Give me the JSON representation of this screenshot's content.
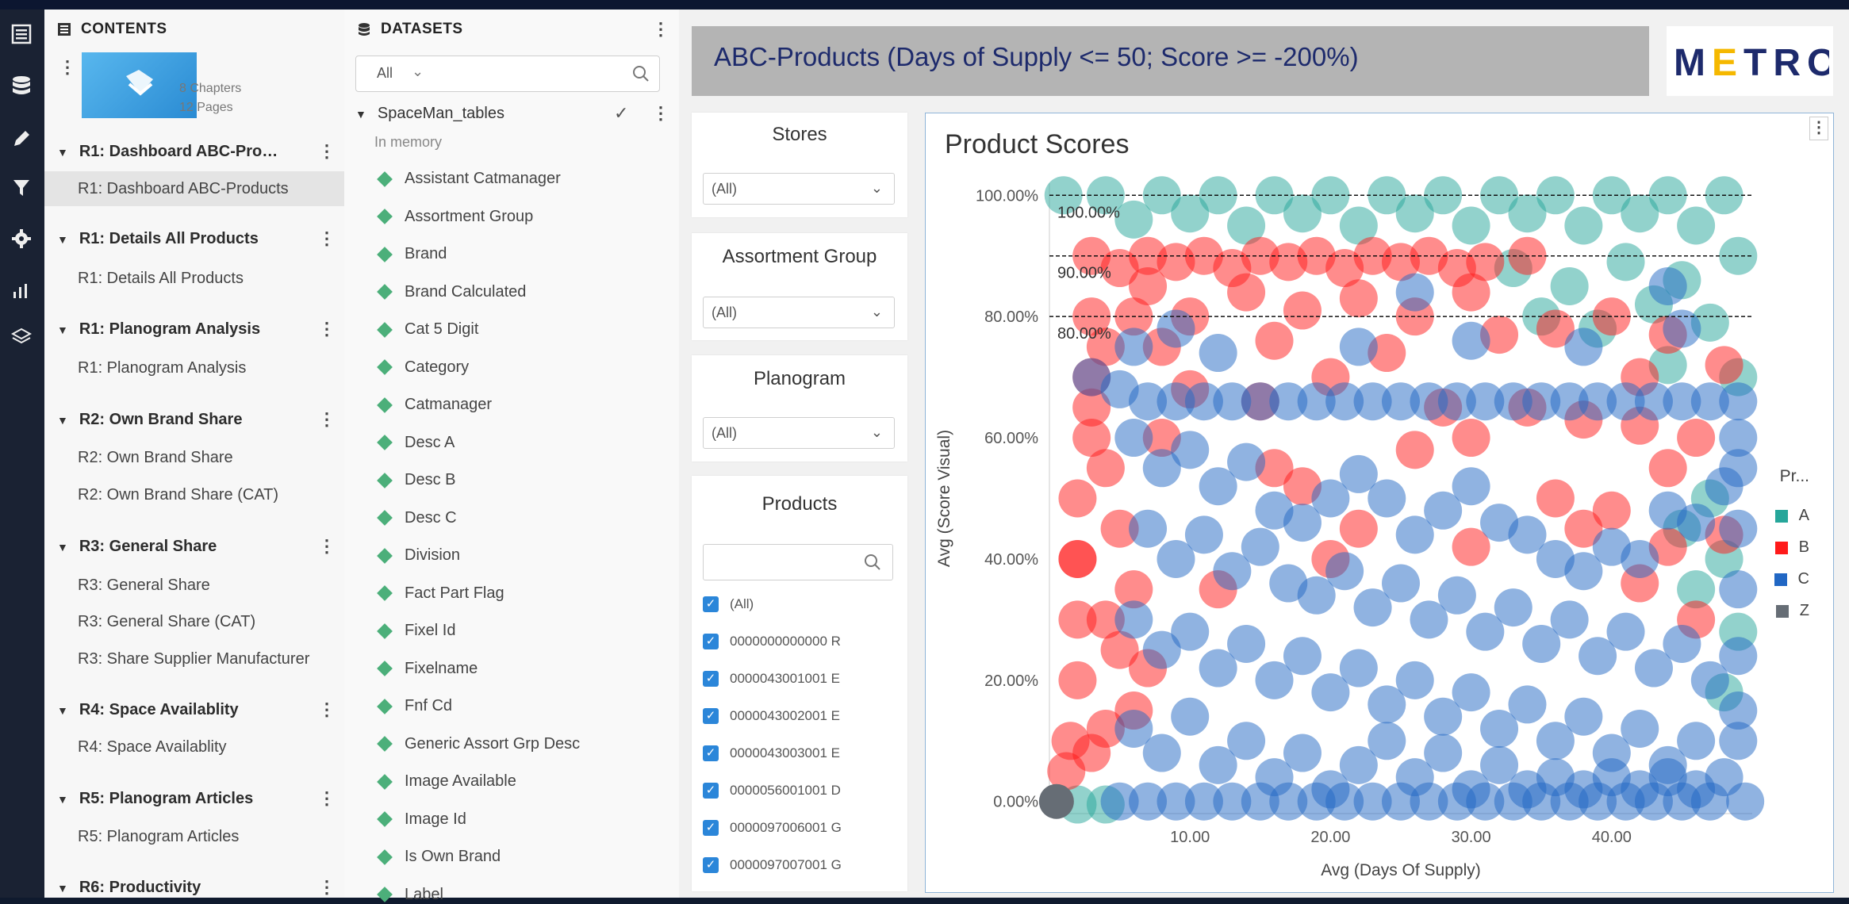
{
  "contents": {
    "header": "CONTENTS",
    "stats": {
      "chapters": "8 Chapters",
      "pages": "12 Pages"
    },
    "chapters": [
      {
        "title": "R1: Dashboard ABC-Pro…",
        "pages": [
          "R1: Dashboard ABC-Products"
        ]
      },
      {
        "title": "R1: Details All Products",
        "pages": [
          "R1: Details All Products"
        ]
      },
      {
        "title": "R1: Planogram Analysis",
        "pages": [
          "R1: Planogram Analysis"
        ]
      },
      {
        "title": "R2: Own Brand Share",
        "pages": [
          "R2: Own Brand Share",
          "R2: Own Brand Share (CAT)"
        ]
      },
      {
        "title": "R3: General Share",
        "pages": [
          "R3: General Share",
          "R3: General Share (CAT)",
          "R3: Share Supplier Manufacturer"
        ]
      },
      {
        "title": "R4: Space Availablity",
        "pages": [
          "R4: Space Availablity"
        ]
      },
      {
        "title": "R5: Planogram Articles",
        "pages": [
          "R5: Planogram Articles"
        ]
      },
      {
        "title": "R6: Productivity",
        "pages": []
      }
    ]
  },
  "datasets": {
    "header": "DATASETS",
    "filter": "All",
    "dataset_name": "SpaceMan_tables",
    "dataset_status": "In memory",
    "attributes": [
      "Assistant Catmanager",
      "Assortment Group",
      "Brand",
      "Brand Calculated",
      "Cat 5 Digit",
      "Category",
      "Catmanager",
      "Desc A",
      "Desc B",
      "Desc C",
      "Division",
      "Fact Part Flag",
      "Fixel Id",
      "Fixelname",
      "Fnf Cd",
      "Generic Assort Grp Desc",
      "Image Available",
      "Image Id",
      "Is Own Brand",
      "Label"
    ]
  },
  "dashboard": {
    "title": "ABC-Products (Days of Supply <= 50; Score >= -200%)",
    "logo": "METRO",
    "filters": [
      {
        "title": "Stores",
        "value": "(All)"
      },
      {
        "title": "Assortment Group",
        "value": "(All)"
      },
      {
        "title": "Planogram",
        "value": "(All)"
      }
    ],
    "products": {
      "title": "Products",
      "items": [
        "(All)",
        "0000000000000 R",
        "0000043001001 E",
        "0000043002001 E",
        "0000043003001 E",
        "0000056001001 D",
        "0000097006001 G",
        "0000097007001 G"
      ]
    }
  },
  "chart_data": {
    "type": "scatter",
    "title": "Product Scores",
    "xlabel": "Avg (Days Of Supply)",
    "ylabel": "Avg (Score Visual)",
    "xlim": [
      0,
      50
    ],
    "ylim": [
      -2,
      102
    ],
    "x_ticks": [
      "10.00",
      "20.00",
      "30.00",
      "40.00"
    ],
    "y_ticks": [
      "0.00%",
      "20.00%",
      "40.00%",
      "60.00%",
      "80.00%",
      "100.00%"
    ],
    "reference_lines": [
      {
        "value": 100,
        "label": "100.00%"
      },
      {
        "value": 90,
        "label": "90.00%"
      },
      {
        "value": 80,
        "label": "80.00%"
      }
    ],
    "legend_title": "Pr...",
    "legend_position": "right",
    "series": [
      {
        "name": "A",
        "color": "#26a69a",
        "points": [
          [
            1,
            100
          ],
          [
            4,
            100
          ],
          [
            8,
            100
          ],
          [
            12,
            100
          ],
          [
            16,
            100
          ],
          [
            20,
            100
          ],
          [
            24,
            100
          ],
          [
            28,
            100
          ],
          [
            32,
            100
          ],
          [
            36,
            100
          ],
          [
            40,
            100
          ],
          [
            44,
            100
          ],
          [
            48,
            100
          ],
          [
            6,
            96
          ],
          [
            10,
            97
          ],
          [
            14,
            95
          ],
          [
            18,
            97
          ],
          [
            22,
            95
          ],
          [
            26,
            97
          ],
          [
            30,
            95
          ],
          [
            34,
            97
          ],
          [
            38,
            95
          ],
          [
            42,
            97
          ],
          [
            46,
            95
          ],
          [
            33,
            88
          ],
          [
            37,
            85
          ],
          [
            41,
            89
          ],
          [
            45,
            86
          ],
          [
            49,
            90
          ],
          [
            35,
            80
          ],
          [
            39,
            78
          ],
          [
            43,
            82
          ],
          [
            47,
            79
          ],
          [
            49,
            70
          ],
          [
            44,
            72
          ],
          [
            47,
            50
          ],
          [
            45,
            45
          ],
          [
            48,
            40
          ],
          [
            46,
            35
          ],
          [
            49,
            28
          ],
          [
            48,
            18
          ],
          [
            2,
            -0.5
          ],
          [
            4,
            -0.5
          ]
        ]
      },
      {
        "name": "B",
        "color": "#ff1a1a",
        "points": [
          [
            3,
            90
          ],
          [
            5,
            88
          ],
          [
            7,
            90
          ],
          [
            9,
            89
          ],
          [
            11,
            90
          ],
          [
            13,
            88
          ],
          [
            15,
            90
          ],
          [
            17,
            89
          ],
          [
            19,
            90
          ],
          [
            21,
            88
          ],
          [
            23,
            90
          ],
          [
            25,
            89
          ],
          [
            27,
            90
          ],
          [
            29,
            88
          ],
          [
            31,
            89
          ],
          [
            34,
            90
          ],
          [
            3,
            80
          ],
          [
            3,
            70
          ],
          [
            3,
            60
          ],
          [
            2,
            50
          ],
          [
            2,
            40
          ],
          [
            2,
            30
          ],
          [
            2,
            20
          ],
          [
            1.5,
            10
          ],
          [
            1.2,
            5
          ],
          [
            4,
            55
          ],
          [
            5,
            45
          ],
          [
            6,
            35
          ],
          [
            5,
            25
          ],
          [
            7,
            85
          ],
          [
            10,
            80
          ],
          [
            14,
            84
          ],
          [
            18,
            81
          ],
          [
            22,
            83
          ],
          [
            26,
            80
          ],
          [
            30,
            84
          ],
          [
            8,
            75
          ],
          [
            16,
            76
          ],
          [
            24,
            74
          ],
          [
            32,
            77
          ],
          [
            36,
            78
          ],
          [
            40,
            80
          ],
          [
            44,
            77
          ],
          [
            42,
            70
          ],
          [
            48,
            72
          ],
          [
            28,
            65
          ],
          [
            34,
            65
          ],
          [
            38,
            63
          ],
          [
            42,
            62
          ],
          [
            46,
            60
          ],
          [
            30,
            60
          ],
          [
            26,
            58
          ],
          [
            16,
            55
          ],
          [
            18,
            52
          ],
          [
            44,
            55
          ],
          [
            40,
            48
          ],
          [
            36,
            50
          ],
          [
            22,
            45
          ],
          [
            30,
            42
          ],
          [
            38,
            45
          ],
          [
            44,
            42
          ],
          [
            48,
            44
          ],
          [
            42,
            36
          ],
          [
            46,
            30
          ],
          [
            12,
            35
          ],
          [
            20,
            40
          ],
          [
            8,
            60
          ],
          [
            10,
            68
          ],
          [
            20,
            70
          ],
          [
            15,
            66
          ],
          [
            3,
            65
          ],
          [
            4,
            75
          ],
          [
            6,
            80
          ],
          [
            2,
            40
          ],
          [
            4,
            30
          ],
          [
            4,
            12
          ],
          [
            3,
            8
          ],
          [
            6,
            15
          ],
          [
            7,
            22
          ]
        ]
      },
      {
        "name": "C",
        "color": "#2167c4",
        "points": [
          [
            3,
            70
          ],
          [
            5,
            68
          ],
          [
            7,
            66
          ],
          [
            9,
            66
          ],
          [
            11,
            66
          ],
          [
            13,
            66
          ],
          [
            15,
            66
          ],
          [
            17,
            66
          ],
          [
            19,
            66
          ],
          [
            21,
            66
          ],
          [
            23,
            66
          ],
          [
            25,
            66
          ],
          [
            27,
            66
          ],
          [
            29,
            66
          ],
          [
            31,
            66
          ],
          [
            33,
            66
          ],
          [
            35,
            66
          ],
          [
            37,
            66
          ],
          [
            39,
            66
          ],
          [
            41,
            66
          ],
          [
            43,
            66
          ],
          [
            45,
            66
          ],
          [
            47,
            66
          ],
          [
            49,
            66
          ],
          [
            6,
            75
          ],
          [
            9,
            78
          ],
          [
            12,
            74
          ],
          [
            6,
            60
          ],
          [
            8,
            55
          ],
          [
            10,
            58
          ],
          [
            12,
            52
          ],
          [
            14,
            56
          ],
          [
            16,
            48
          ],
          [
            18,
            46
          ],
          [
            20,
            50
          ],
          [
            22,
            54
          ],
          [
            24,
            50
          ],
          [
            26,
            44
          ],
          [
            28,
            48
          ],
          [
            30,
            52
          ],
          [
            32,
            46
          ],
          [
            34,
            44
          ],
          [
            36,
            40
          ],
          [
            38,
            38
          ],
          [
            40,
            42
          ],
          [
            42,
            40
          ],
          [
            44,
            48
          ],
          [
            46,
            46
          ],
          [
            48,
            52
          ],
          [
            7,
            45
          ],
          [
            9,
            40
          ],
          [
            11,
            44
          ],
          [
            13,
            38
          ],
          [
            15,
            42
          ],
          [
            17,
            36
          ],
          [
            19,
            34
          ],
          [
            21,
            38
          ],
          [
            23,
            32
          ],
          [
            25,
            36
          ],
          [
            27,
            30
          ],
          [
            29,
            34
          ],
          [
            31,
            28
          ],
          [
            33,
            32
          ],
          [
            35,
            26
          ],
          [
            37,
            30
          ],
          [
            39,
            24
          ],
          [
            41,
            28
          ],
          [
            43,
            22
          ],
          [
            45,
            26
          ],
          [
            47,
            20
          ],
          [
            49,
            24
          ],
          [
            6,
            30
          ],
          [
            8,
            25
          ],
          [
            10,
            28
          ],
          [
            12,
            22
          ],
          [
            14,
            26
          ],
          [
            16,
            20
          ],
          [
            18,
            24
          ],
          [
            20,
            18
          ],
          [
            22,
            22
          ],
          [
            24,
            16
          ],
          [
            26,
            20
          ],
          [
            28,
            14
          ],
          [
            30,
            18
          ],
          [
            32,
            12
          ],
          [
            34,
            16
          ],
          [
            36,
            10
          ],
          [
            38,
            14
          ],
          [
            40,
            8
          ],
          [
            42,
            12
          ],
          [
            44,
            6
          ],
          [
            46,
            10
          ],
          [
            48,
            4
          ],
          [
            6,
            12
          ],
          [
            8,
            8
          ],
          [
            10,
            14
          ],
          [
            12,
            6
          ],
          [
            14,
            10
          ],
          [
            16,
            4
          ],
          [
            18,
            8
          ],
          [
            20,
            2
          ],
          [
            22,
            6
          ],
          [
            24,
            10
          ],
          [
            26,
            4
          ],
          [
            28,
            8
          ],
          [
            30,
            2
          ],
          [
            32,
            6
          ],
          [
            34,
            2
          ],
          [
            36,
            4
          ],
          [
            38,
            2
          ],
          [
            40,
            4
          ],
          [
            42,
            2
          ],
          [
            44,
            4
          ],
          [
            46,
            2
          ],
          [
            5,
            0
          ],
          [
            7,
            0
          ],
          [
            9,
            0
          ],
          [
            11,
            0
          ],
          [
            13,
            0
          ],
          [
            15,
            0
          ],
          [
            17,
            0
          ],
          [
            19,
            0
          ],
          [
            21,
            0
          ],
          [
            23,
            0
          ],
          [
            25,
            0
          ],
          [
            27,
            0
          ],
          [
            29,
            0
          ],
          [
            31,
            0
          ],
          [
            33,
            0
          ],
          [
            35,
            0
          ],
          [
            37,
            0
          ],
          [
            39,
            0
          ],
          [
            41,
            0
          ],
          [
            43,
            0
          ],
          [
            45,
            0
          ],
          [
            47,
            0
          ],
          [
            49.5,
            0
          ],
          [
            49,
            10
          ],
          [
            49,
            15
          ],
          [
            49,
            35
          ],
          [
            49,
            45
          ],
          [
            49,
            55
          ],
          [
            49,
            60
          ],
          [
            22,
            75
          ],
          [
            30,
            76
          ],
          [
            38,
            75
          ],
          [
            45,
            78
          ],
          [
            26,
            84
          ],
          [
            44,
            85
          ]
        ]
      },
      {
        "name": "Z",
        "color": "#666d75",
        "points": [
          [
            0.5,
            0
          ]
        ]
      }
    ]
  },
  "colors": {
    "accent": "#2b86d9",
    "title_bar": "#b4b4b4",
    "title_text": "#1d2a6c",
    "diamond": "#4caf7a",
    "logo_yellow": "#f5b800",
    "logo_blue": "#1d2a6c"
  },
  "icons": [
    "table-of-contents-icon",
    "database-icon",
    "pencil-icon",
    "filter-icon",
    "gear-icon",
    "chart-icon",
    "layers-icon",
    "search-icon",
    "check-icon",
    "chevron-down-icon"
  ]
}
